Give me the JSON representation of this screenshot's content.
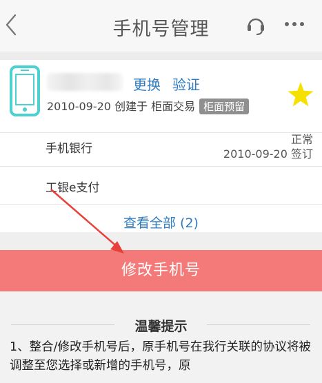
{
  "header": {
    "title": "手机号管理"
  },
  "phone_card": {
    "change_label": "更换",
    "verify_label": "验证",
    "created_text": "2010-09-20 创建于 柜面交易",
    "tag": "柜面预留"
  },
  "services": [
    {
      "label": "手机银行",
      "status": "正常",
      "date": "2010-09-20",
      "status_note": "签订"
    },
    {
      "label": "工银e支付"
    }
  ],
  "view_all_label": "查看全部 (2)",
  "modify_button_label": "修改手机号",
  "tips": {
    "title": "温馨提示",
    "text": "1、整合/修改手机号后，原手机号在我行关联的协议将被调整至您选择或新增的手机号，原"
  },
  "colors": {
    "accent_link": "#2f7cc1",
    "primary_button": "#f47a7a",
    "phone_icon": "#4dd0d0",
    "star": "#f5e100",
    "annotation_arrow": "#e8413b"
  },
  "icons": {
    "back": "chevron-left-icon",
    "support": "headset-icon",
    "more": "more-dots-icon",
    "phone": "mobile-phone-icon",
    "star": "star-icon"
  }
}
